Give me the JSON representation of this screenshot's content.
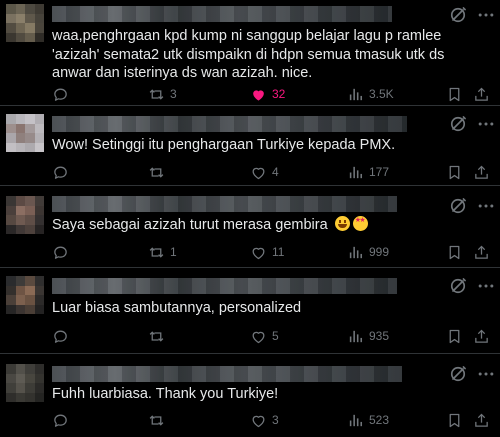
{
  "replies": [
    {
      "text": "waa,penghrgaan kpd kump ni sanggup belajar lagu p ramlee 'azizah' semata2 utk dismpaikn di hdpn semua tmasuk utk ds anwar dan isterinya ds wan azizah. nice.",
      "emoji": [],
      "reply_count": "",
      "repost_count": "3",
      "like_count": "32",
      "liked": true,
      "views": "3.5K"
    },
    {
      "text": "Wow! Setinggi itu penghargaan Turkiye kepada PMX.",
      "emoji": [],
      "reply_count": "",
      "repost_count": "",
      "like_count": "4",
      "liked": false,
      "views": "177"
    },
    {
      "text": "Saya sebagai azizah turut merasa gembira ",
      "emoji": [
        "grinning-face-emoji",
        "star-struck-emoji"
      ],
      "reply_count": "",
      "repost_count": "1",
      "like_count": "11",
      "liked": false,
      "views": "999"
    },
    {
      "text": "Luar biasa sambutannya, personalized",
      "emoji": [],
      "reply_count": "",
      "repost_count": "",
      "like_count": "5",
      "liked": false,
      "views": "935"
    },
    {
      "text": "Fuhh luarbiasa. Thank you Turkiye!",
      "emoji": [],
      "reply_count": "",
      "repost_count": "",
      "like_count": "3",
      "liked": false,
      "views": "523"
    }
  ],
  "icons": {
    "mute": "mute-conversation-icon",
    "more": "more-icon",
    "reply": "reply-icon",
    "repost": "repost-icon",
    "like": "like-icon",
    "views": "views-icon",
    "bookmark": "bookmark-icon",
    "share": "share-icon"
  },
  "colors": {
    "background": "#000000",
    "text": "#e7e9ea",
    "muted": "#71767b",
    "like_active": "#f91880",
    "divider": "#2f3336"
  }
}
